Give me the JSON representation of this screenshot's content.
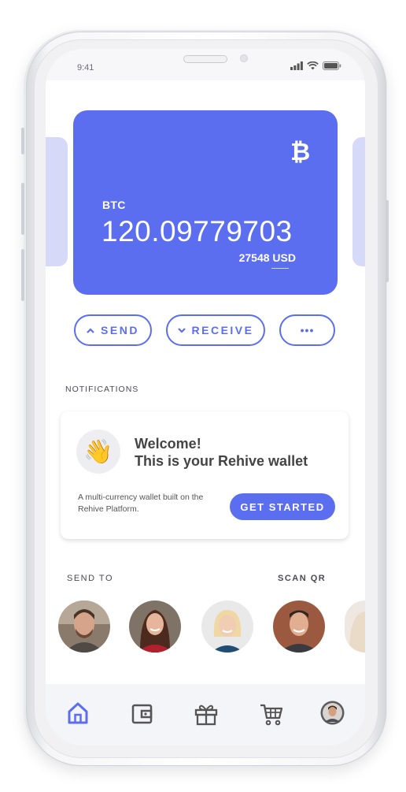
{
  "status_bar": {
    "time": "9:41"
  },
  "card": {
    "currency": "BTC",
    "balance": "120.09779703",
    "fiat_value": "27548 USD",
    "symbol": "₿"
  },
  "actions": {
    "send": "SEND",
    "receive": "RECEIVE",
    "more": "•••"
  },
  "notifications": {
    "heading": "NOTIFICATIONS",
    "emoji": "👋",
    "title_line1": "Welcome!",
    "title_line2": "This is your Rehive wallet",
    "description": "A multi-currency wallet built on the Rehive Platform.",
    "cta": "GET STARTED"
  },
  "contacts": {
    "send_to": "SEND TO",
    "scan_qr": "SCAN QR",
    "people": [
      "contact-1",
      "contact-2",
      "contact-3",
      "contact-4",
      "contact-5"
    ]
  },
  "nav": {
    "items": [
      "home-icon",
      "wallet-icon",
      "gift-icon",
      "cart-icon",
      "profile-avatar"
    ],
    "active": "home-icon"
  },
  "colors": {
    "accent": "#5b6ef0",
    "card_peek": "#d7d9f8"
  }
}
